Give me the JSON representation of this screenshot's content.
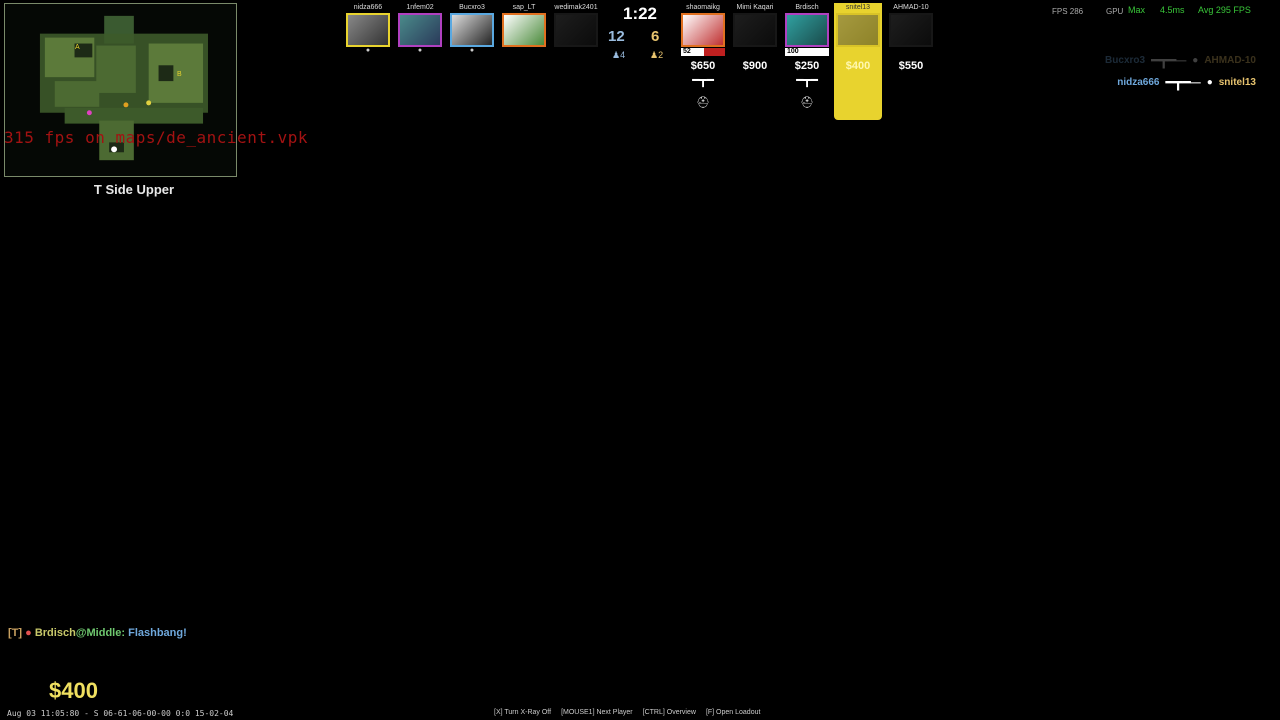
{
  "minimap": {
    "zone": "T Side Upper",
    "console": "315 fps on maps/de_ancient.vpk",
    "labels": [
      "A",
      "B"
    ]
  },
  "round": {
    "timer": "1:22",
    "score_ct": "12",
    "score_t": "6",
    "alive_ct": "♟4",
    "alive_t": "♟2"
  },
  "team_ct": [
    {
      "name": "nidza666",
      "border": "#e8d32e"
    },
    {
      "name": "1nfem02",
      "border": "#b040c0"
    },
    {
      "name": "Bucxro3",
      "border": "#5aa8e0"
    },
    {
      "name": "sap_LT",
      "border": "#e07020"
    },
    {
      "name": "wedimak2401",
      "border": "#444"
    }
  ],
  "team_t": [
    {
      "name": "shaomaikg",
      "money": "$650",
      "hp": "52",
      "weapon": "━┳━",
      "kit": "⛑",
      "border": "#e07020"
    },
    {
      "name": "Mimi Kaqari",
      "money": "$900",
      "hp": "",
      "weapon": "",
      "kit": "",
      "border": "#444"
    },
    {
      "name": "Brdisch",
      "money": "$250",
      "hp": "100",
      "weapon": "━┳━",
      "kit": "⛑",
      "border": "#b040c0"
    },
    {
      "name": "snitel13",
      "money": "$400",
      "hp": "",
      "weapon": "",
      "kit": "",
      "border": "#e8d32e"
    },
    {
      "name": "AHMAD-10",
      "money": "$550",
      "hp": "",
      "weapon": "",
      "kit": "",
      "border": "#444"
    }
  ],
  "perf": {
    "fps": "FPS 286",
    "gpu": "GPU",
    "max": "Max",
    "ms": "4.5ms",
    "avg": "Avg 295 FPS"
  },
  "killfeed": [
    {
      "attacker": "Bucxro3",
      "victim": "AHMAD-10",
      "weapon": "━┳━─"
    },
    {
      "attacker": "nidza666",
      "victim": "snitel13",
      "weapon": "━┳━─"
    }
  ],
  "chat": {
    "tag": "[T]",
    "dot": "●",
    "player": "Brdisch",
    "location": "@Middle:",
    "message": "Flashbang!"
  },
  "money": "$400",
  "datebar": "Aug 03 11:05:80 - S 06-61-06-00-00 0:0 15-02-04",
  "hints": [
    "[X] Turn X-Ray Off",
    "[MOUSE1] Next Player",
    "[CTRL] Overview",
    "[F] Open Loadout"
  ],
  "colors": {
    "ct": "#6fa8dc",
    "t": "#e8c46f",
    "highlight": "#e8d32e"
  }
}
